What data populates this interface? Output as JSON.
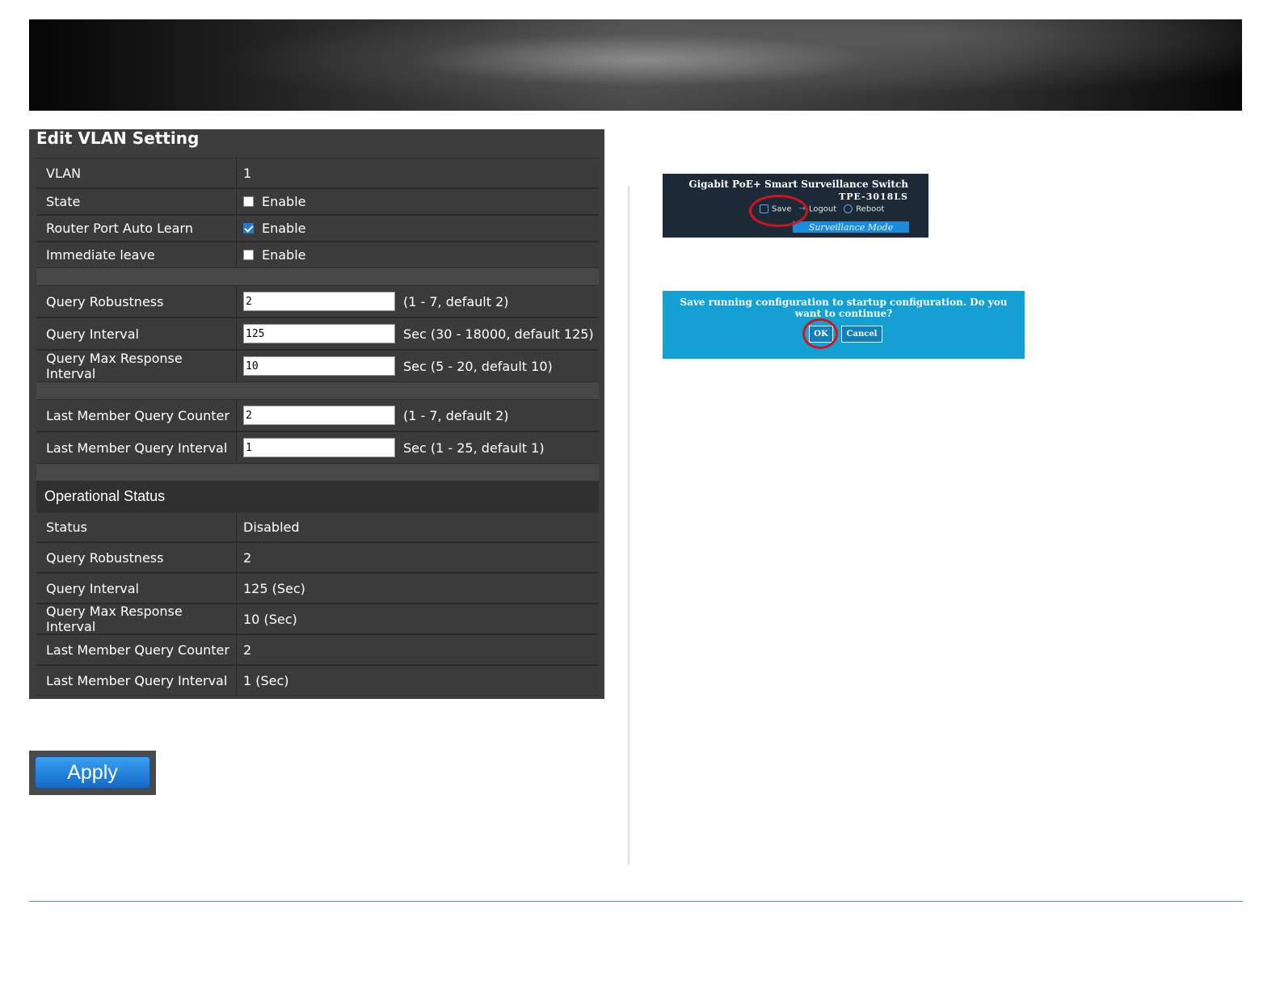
{
  "panel": {
    "title": "Edit VLAN Setting",
    "enable_label": "Enable",
    "rows": {
      "vlan": {
        "label": "VLAN",
        "value": "1"
      },
      "state": {
        "label": "State",
        "checked": false
      },
      "router_port": {
        "label": "Router Port Auto Learn",
        "checked": true
      },
      "immediate_leave": {
        "label": "Immediate leave",
        "checked": false
      },
      "query_robustness": {
        "label": "Query Robustness",
        "value": "2",
        "hint": "(1 - 7, default 2)"
      },
      "query_interval": {
        "label": "Query Interval",
        "value": "125",
        "hint": "Sec (30 - 18000, default 125)"
      },
      "query_max_response": {
        "label": "Query Max Response Interval",
        "value": "10",
        "hint": "Sec (5 - 20, default 10)"
      },
      "last_member_counter": {
        "label": "Last Member Query Counter",
        "value": "2",
        "hint": "(1 - 7, default 2)"
      },
      "last_member_interval": {
        "label": "Last Member Query Interval",
        "value": "1",
        "hint": "Sec (1 - 25, default 1)"
      }
    },
    "operational": {
      "title": "Operational Status",
      "status": {
        "label": "Status",
        "value": "Disabled"
      },
      "query_robustness": {
        "label": "Query Robustness",
        "value": "2"
      },
      "query_interval": {
        "label": "Query Interval",
        "value": "125 (Sec)"
      },
      "query_max_response": {
        "label": "Query Max Response Interval",
        "value": "10 (Sec)"
      },
      "last_member_counter": {
        "label": "Last Member Query Counter",
        "value": "2"
      },
      "last_member_interval": {
        "label": "Last Member Query Interval",
        "value": "1 (Sec)"
      }
    }
  },
  "apply_label": "Apply",
  "switch_header": {
    "product": "Gigabit PoE+ Smart Surveillance Switch",
    "model": "TPE-3018LS",
    "save": "Save",
    "logout": "Logout",
    "reboot": "Reboot",
    "mode": "Surveillance Mode"
  },
  "save_dialog": {
    "message": "Save running configuration to startup configuration. Do you want to continue?",
    "ok": "OK",
    "cancel": "Cancel"
  },
  "colors": {
    "panel_bg": "#3d3d3d",
    "apply_blue": "#1e7ad3",
    "dialog_blue": "#14a0d2",
    "highlight_red": "#d4121c",
    "footer_line": "#4d8fd0"
  }
}
